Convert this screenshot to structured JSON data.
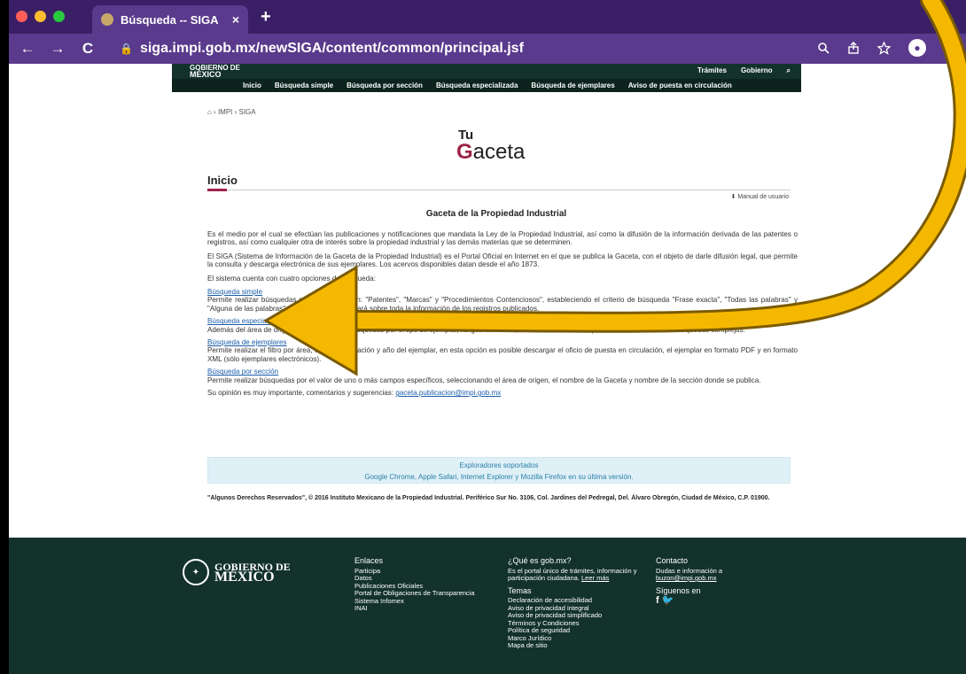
{
  "browser": {
    "tab_title": "Búsqueda -- SIGA",
    "tab_close": "×",
    "new_tab": "+",
    "back": "←",
    "forward": "→",
    "reload": "C",
    "url": "siga.impi.gob.mx/newSIGA/content/common/principal.jsf",
    "icons": [
      "zoom-icon",
      "share-icon",
      "star-icon",
      "profile-icon",
      "menu-icon"
    ],
    "traffic_light_colors": [
      "#ff5f57",
      "#febc2e",
      "#28c840"
    ]
  },
  "gov_header": {
    "logo_small": "GOBIERNO DE",
    "logo_big": "MÉXICO",
    "top_links": [
      "Trámites",
      "Gobierno"
    ],
    "search_icon": "⌕",
    "nav": [
      "Inicio",
      "Búsqueda simple",
      "Búsqueda por sección",
      "Búsqueda especializada",
      "Búsqueda de ejemplares",
      "Aviso de puesta en circulación"
    ]
  },
  "content": {
    "breadcrumb": "⌂ › IMPI › SIGA",
    "logo_tu": "Tu",
    "logo_g": "G",
    "logo_rest": "aceta",
    "page_title": "Inicio",
    "manual_link": "⬇ Manual de usuario",
    "heading": "Gaceta de la Propiedad Industrial",
    "paragraph1": "Es el medio por el cual se efectúan las publicaciones y notificaciones que mandata la Ley de la Propiedad Industrial, así como la difusión de la información derivada de las patentes o registros, así como cualquier otra de interés sobre la propiedad industrial y las demás materias que se determinen.",
    "paragraph2": "El SIGA (Sistema de Información de la Gaceta de la Propiedad Industrial) es el Portal Oficial en Internet en el que se publica la Gaceta, con el objeto de darle difusión legal, que permite la consulta y descarga electrónica de sus ejemplares. Los acervos disponibles datan desde el año 1873.",
    "paragraph3": "El sistema cuenta con cuatro opciones de búsqueda:",
    "options": [
      {
        "link": "Búsqueda simple",
        "desc": "Permite realizar búsquedas por área de origen: \"Patentes\", \"Marcas\" y \"Procedimientos Contenciosos\", estableciendo el criterio de búsqueda \"Frase exacta\", \"Todas las palabras\" y \"Alguna de las palabras\", la búsqueda se realizará sobre toda la información de los registros publicados."
      },
      {
        "link": "Búsqueda especializada",
        "desc": "Además del área de origen, permite realizar búsquedas por el tipo de ejemplar, rangos de fechas, cuenta también con la posibilidad de estructurar búsquedas complejas."
      },
      {
        "link": "Búsqueda de ejemplares",
        "desc": "Permite realizar el filtro por área, tipo de publicación y año del ejemplar, en esta opción es posible descargar el oficio de puesta en circulación, el ejemplar en formato PDF y en formato XML (sólo ejemplares electrónicos)."
      },
      {
        "link": "Búsqueda por sección",
        "desc": "Permite realizar búsquedas por el valor de uno o más campos específicos, seleccionando el área de origen, el nombre de la Gaceta y nombre de la sección donde se publica."
      }
    ],
    "opinion_text": "Su opinión es muy importante, comentarios y sugerencias:",
    "opinion_email": "gaceta.publicacion@impi.gob.mx",
    "supported_title": "Exploradores soportados",
    "supported_list": "Google Chrome, Apple Safari, Internet Explorer y Mozilla Firefox en su última versión.",
    "copyright": "\"Algunos Derechos Reservados\", © 2016 Instituto Mexicano de la Propiedad Industrial. Periférico Sur No. 3106, Col. Jardines del Pedregal, Del. Álvaro Obregón, Ciudad de México, C.P. 01900."
  },
  "footer": {
    "logo_line1": "GOBIERNO DE",
    "logo_line2": "MÉXICO",
    "enlaces_title": "Enlaces",
    "enlaces": [
      "Participa",
      "Datos",
      "Publicaciones Oficiales",
      "Portal de Obligaciones de Transparencia",
      "Sistema Infomex",
      "INAI"
    ],
    "que_es_title": "¿Qué es gob.mx?",
    "que_es_text": "Es el portal único de trámites, información y participación ciudadana.",
    "leer_mas": "Leer más",
    "temas_title": "Temas",
    "temas": [
      "Declaración de accesibilidad",
      "Aviso de privacidad integral",
      "Aviso de privacidad simplificado",
      "Términos y Condiciones",
      "Política de seguridad",
      "Marco Jurídico",
      "Mapa de sitio"
    ],
    "contacto_title": "Contacto",
    "contacto_text": "Dudas e información a",
    "contacto_email": "buzon@impi.gob.mx",
    "siguenos": "Síguenos en",
    "social": "f 🐦"
  },
  "annotation": {
    "arrow_color": "#f5b800"
  }
}
